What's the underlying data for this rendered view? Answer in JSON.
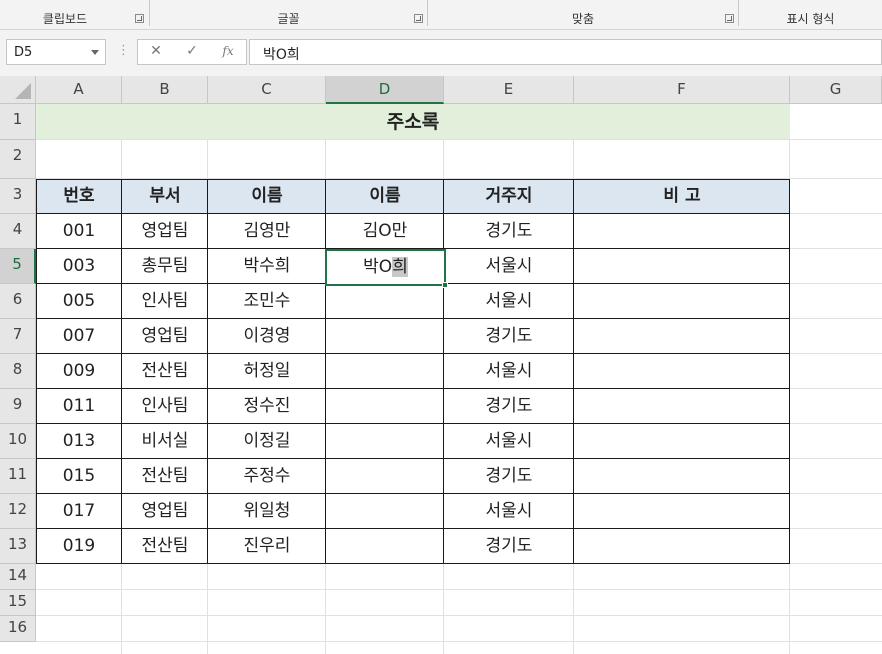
{
  "ribbon": {
    "groups": [
      {
        "label": "클립보드"
      },
      {
        "label": "글꼴"
      },
      {
        "label": "맞춤"
      },
      {
        "label": "표시 형식"
      }
    ]
  },
  "formula_bar": {
    "name_box": "D5",
    "dots": "⋮",
    "cancel_icon": "✕",
    "enter_icon": "✓",
    "fx_label": "fx",
    "formula": "박O희"
  },
  "sheet": {
    "columns": [
      "A",
      "B",
      "C",
      "D",
      "E",
      "F",
      "G"
    ],
    "selected_column": "D",
    "rows": [
      "1",
      "2",
      "3",
      "4",
      "5",
      "6",
      "7",
      "8",
      "9",
      "10",
      "11",
      "12",
      "13",
      "14",
      "15",
      "16"
    ],
    "selected_row": "5",
    "title": "주소록",
    "headers": [
      "번호",
      "부서",
      "이름",
      "이름",
      "거주지",
      "비  고"
    ],
    "data": [
      {
        "no": "001",
        "dept": "영업팀",
        "name": "김영만",
        "masked": "김O만",
        "addr": "경기도",
        "note": ""
      },
      {
        "no": "003",
        "dept": "총무팀",
        "name": "박수희",
        "masked": "",
        "addr": "서울시",
        "note": ""
      },
      {
        "no": "005",
        "dept": "인사팀",
        "name": "조민수",
        "masked": "",
        "addr": "서울시",
        "note": ""
      },
      {
        "no": "007",
        "dept": "영업팀",
        "name": "이경영",
        "masked": "",
        "addr": "경기도",
        "note": ""
      },
      {
        "no": "009",
        "dept": "전산팀",
        "name": "허정일",
        "masked": "",
        "addr": "서울시",
        "note": ""
      },
      {
        "no": "011",
        "dept": "인사팀",
        "name": "정수진",
        "masked": "",
        "addr": "경기도",
        "note": ""
      },
      {
        "no": "013",
        "dept": "비서실",
        "name": "이정길",
        "masked": "",
        "addr": "서울시",
        "note": ""
      },
      {
        "no": "015",
        "dept": "전산팀",
        "name": "주정수",
        "masked": "",
        "addr": "경기도",
        "note": ""
      },
      {
        "no": "017",
        "dept": "영업팀",
        "name": "위일청",
        "masked": "",
        "addr": "서울시",
        "note": ""
      },
      {
        "no": "019",
        "dept": "전산팀",
        "name": "진우리",
        "masked": "",
        "addr": "경기도",
        "note": ""
      }
    ],
    "active_cell": {
      "prefix": "박O",
      "highlighted": "희"
    }
  },
  "colors": {
    "title_fill": "#e2efda",
    "header_fill": "#dce6f1",
    "selection_accent": "#217346"
  }
}
